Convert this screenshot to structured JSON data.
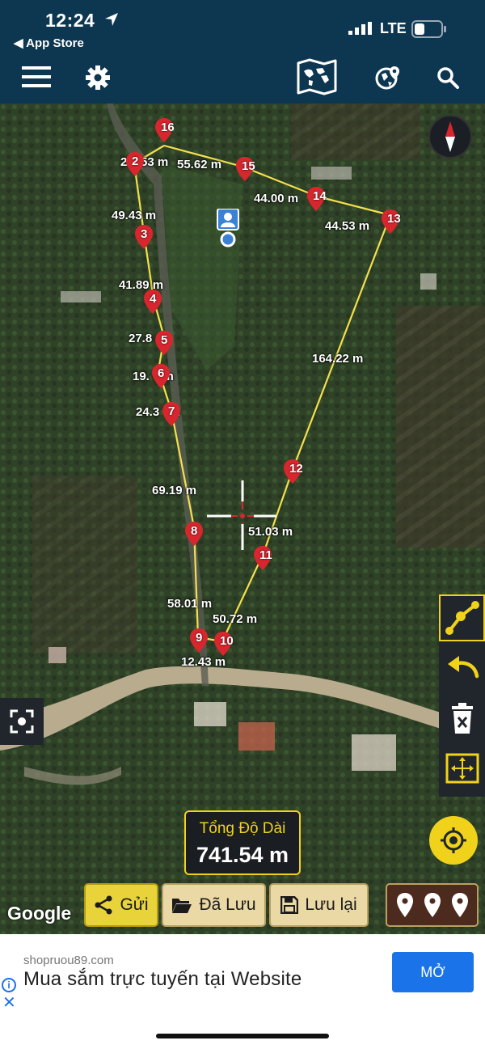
{
  "status": {
    "time": "12:24",
    "back_app": "◀ App Store",
    "network": "LTE"
  },
  "toolbar": {
    "menu_icon": "hamburger-menu-icon",
    "settings_icon": "gear-icon",
    "map_icon": "world-map-icon",
    "globe_icon": "globe-pin-icon",
    "search_icon": "search-icon"
  },
  "map": {
    "distances": [
      {
        "id": "d1",
        "text": "2 2.53 m"
      },
      {
        "id": "d2",
        "text": "55.62 m"
      },
      {
        "id": "d3",
        "text": "44.00 m"
      },
      {
        "id": "d4",
        "text": "44.53 m"
      },
      {
        "id": "d5",
        "text": "49.43 m"
      },
      {
        "id": "d6",
        "text": "41.89 m"
      },
      {
        "id": "d7",
        "text": "27.8   m"
      },
      {
        "id": "d8",
        "text": "19.  6 m"
      },
      {
        "id": "d9",
        "text": "24.3  7m"
      },
      {
        "id": "d10",
        "text": "164.22 m"
      },
      {
        "id": "d11",
        "text": "69.19 m"
      },
      {
        "id": "d12",
        "text": "51.03 m"
      },
      {
        "id": "d13",
        "text": "58.01 m"
      },
      {
        "id": "d14",
        "text": "50.72 m"
      },
      {
        "id": "d15",
        "text": "12.43 m"
      }
    ],
    "pins": [
      {
        "id": "p16",
        "label": "16"
      },
      {
        "id": "p2",
        "label": "2"
      },
      {
        "id": "p15",
        "label": "15"
      },
      {
        "id": "p14",
        "label": "14"
      },
      {
        "id": "p13",
        "label": "13"
      },
      {
        "id": "p3",
        "label": "3"
      },
      {
        "id": "p4",
        "label": "4"
      },
      {
        "id": "p5",
        "label": "5"
      },
      {
        "id": "p6",
        "label": "6"
      },
      {
        "id": "p7",
        "label": "7"
      },
      {
        "id": "p12",
        "label": "12"
      },
      {
        "id": "p8",
        "label": "8"
      },
      {
        "id": "p11",
        "label": "11"
      },
      {
        "id": "p9",
        "label": "9"
      },
      {
        "id": "p10",
        "label": "10"
      }
    ],
    "total_label": "Tổng Độ Dài",
    "total_value": "741.54 m",
    "attribution": "Google",
    "line_color": "#f4e04d",
    "pin_color": "#d7262d"
  },
  "actions": {
    "send": "Gửi",
    "saved": "Đã Lưu",
    "save": "Lưu lại"
  },
  "ad": {
    "domain": "shopruou89.com",
    "title": "Mua sắm trực tuyến tại Website",
    "button": "MỞ"
  }
}
